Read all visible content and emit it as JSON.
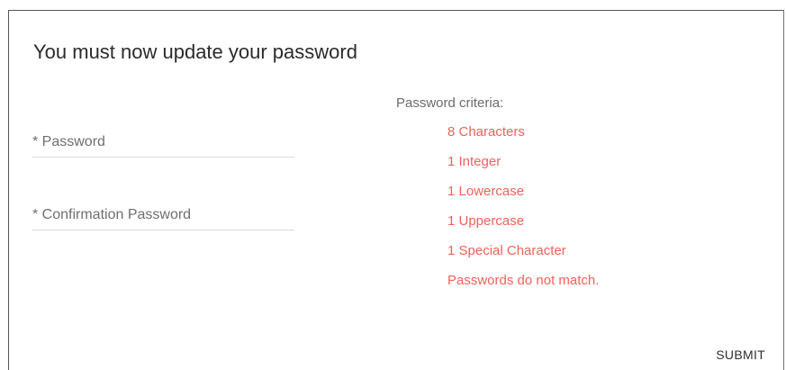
{
  "dialog": {
    "title": "You must now update your password"
  },
  "form": {
    "password_placeholder": "* Password",
    "confirm_placeholder": "* Confirmation Password"
  },
  "criteria": {
    "heading": "Password criteria:",
    "items": [
      "8 Characters",
      "1 Integer",
      "1 Lowercase",
      "1 Uppercase",
      "1 Special Character",
      "Passwords do not match."
    ]
  },
  "actions": {
    "submit_label": "SUBMIT"
  },
  "colors": {
    "error": "#f0625a",
    "title": "#2b2b2b"
  }
}
